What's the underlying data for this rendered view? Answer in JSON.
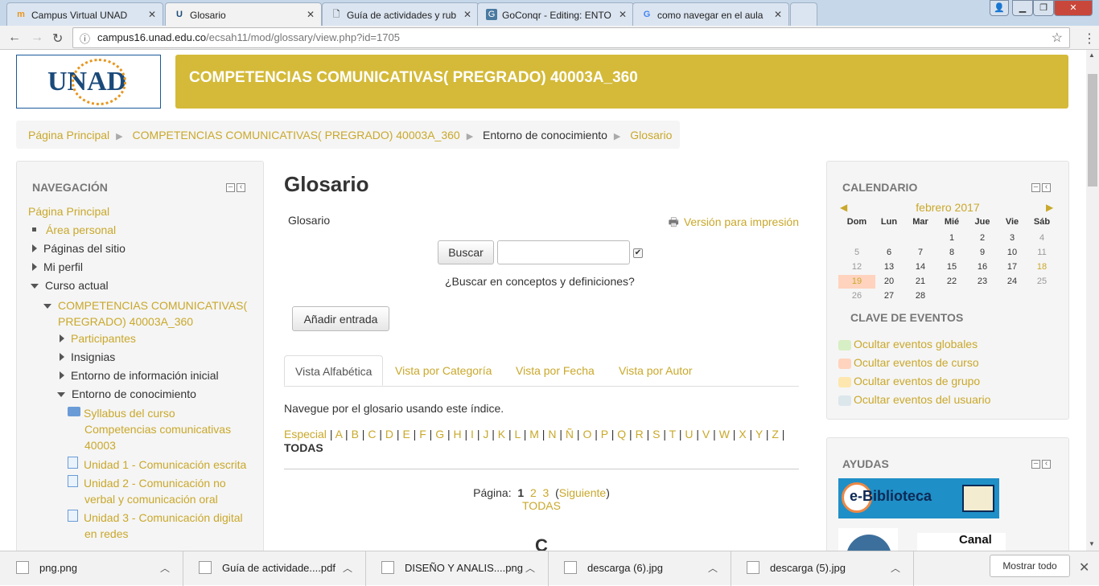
{
  "browser": {
    "tabs": [
      {
        "title": "Campus Virtual UNAD",
        "icon": "moodle-icon",
        "active": false
      },
      {
        "title": "Glosario",
        "icon": "unad-icon",
        "active": true
      },
      {
        "title": "Guía de actividades y rub",
        "icon": "document-icon",
        "active": false
      },
      {
        "title": "GoConqr - Editing: ENTO",
        "icon": "goconqr-icon",
        "active": false
      },
      {
        "title": "como navegar en el aula",
        "icon": "google-icon",
        "active": false
      }
    ],
    "url_host": "campus16.unad.edu.co",
    "url_path": "/ecsah11/mod/glossary/view.php?id=1705"
  },
  "header": {
    "logo_text": "UNAD",
    "course_title": "COMPETENCIAS COMUNICATIVAS( PREGRADO) 40003A_360"
  },
  "breadcrumb": [
    "Página Principal",
    "COMPETENCIAS COMUNICATIVAS( PREGRADO) 40003A_360",
    "Entorno de conocimiento",
    "Glosario"
  ],
  "navigation": {
    "title": "NAVEGACIÓN",
    "home": "Página Principal",
    "personal": "Área personal",
    "site_pages": "Páginas del sitio",
    "profile": "Mi perfil",
    "current_course": "Curso actual",
    "course_line1": "COMPETENCIAS COMUNICATIVAS(",
    "course_line2": "PREGRADO) 40003A_360",
    "participants": "Participantes",
    "badges": "Insignias",
    "initial_env": "Entorno de información inicial",
    "knowledge_env": "Entorno de conocimiento",
    "items": [
      {
        "l1": "Syllabus del curso",
        "l2": "Competencias comunicativas",
        "l3": "40003"
      },
      {
        "l1": "Unidad 1 - Comunicación escrita"
      },
      {
        "l1": "Unidad 2 - Comunicación no",
        "l2": "verbal y comunicación oral"
      },
      {
        "l1": "Unidad 3 - Comunicación digital",
        "l2": "en redes"
      }
    ]
  },
  "main": {
    "title": "Glosario",
    "subtitle": "Glosario",
    "print_link": "Versión para impresión",
    "search_button": "Buscar",
    "search_value": "",
    "search_checkbox_checked": true,
    "search_hint": "¿Buscar en conceptos y definiciones?",
    "add_entry": "Añadir entrada",
    "tabs": [
      "Vista Alfabética",
      "Vista por Categoría",
      "Vista por Fecha",
      "Vista por Autor"
    ],
    "browse_text": "Navegue por el glosario usando este índice.",
    "special": "Especial",
    "letters": [
      "A",
      "B",
      "C",
      "D",
      "E",
      "F",
      "G",
      "H",
      "I",
      "J",
      "K",
      "L",
      "M",
      "N",
      "Ñ",
      "O",
      "P",
      "Q",
      "R",
      "S",
      "T",
      "U",
      "V",
      "W",
      "X",
      "Y",
      "Z"
    ],
    "all": "TODAS",
    "page_label": "Página:",
    "pages": [
      "1",
      "2",
      "3"
    ],
    "next": "Siguiente",
    "all_link": "TODAS",
    "letter_heading": "C"
  },
  "calendar": {
    "title": "CALENDARIO",
    "month": "febrero 2017",
    "weekdays": [
      "Dom",
      "Lun",
      "Mar",
      "Mié",
      "Jue",
      "Vie",
      "Sáb"
    ],
    "weeks": [
      [
        "",
        "",
        "",
        "1",
        "2",
        "3",
        "4"
      ],
      [
        "5",
        "6",
        "7",
        "8",
        "9",
        "10",
        "11"
      ],
      [
        "12",
        "13",
        "14",
        "15",
        "16",
        "17",
        "18"
      ],
      [
        "19",
        "20",
        "21",
        "22",
        "23",
        "24",
        "25"
      ],
      [
        "26",
        "27",
        "28",
        "",
        "",
        "",
        ""
      ]
    ],
    "today": "19",
    "event_day": "18",
    "events_title": "CLAVE DE EVENTOS",
    "events": [
      {
        "label": "Ocultar eventos globales",
        "color": "#d7efc4"
      },
      {
        "label": "Ocultar eventos de curso",
        "color": "#ffd3bd"
      },
      {
        "label": "Ocultar eventos de grupo",
        "color": "#fee7ae"
      },
      {
        "label": "Ocultar eventos del usuario",
        "color": "#dce7ec"
      }
    ]
  },
  "help": {
    "title": "AYUDAS",
    "ebiblioteca": "e-Biblioteca",
    "canal": "Canal"
  },
  "downloads": {
    "items": [
      "png.png",
      "Guía de actividade....pdf",
      "DISEÑO Y ANALIS....png",
      "descarga (6).jpg",
      "descarga (5).jpg"
    ],
    "show_all": "Mostrar todo"
  },
  "colors": {
    "accent": "#d4ba38",
    "link": "#c9a82b"
  }
}
